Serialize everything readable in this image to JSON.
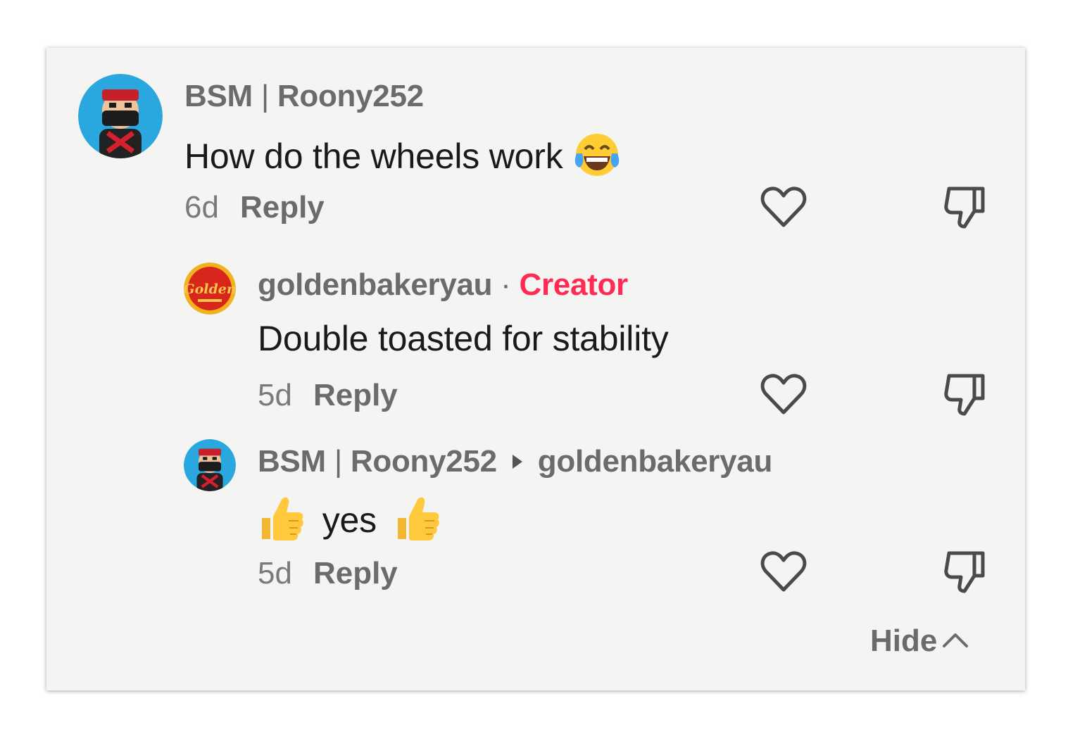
{
  "comments": [
    {
      "username": "BSM",
      "username_sep": "|",
      "username_rest": "Roony252",
      "text": "How do the wheels work",
      "emoji": "tears-of-joy-emoji",
      "age": "6d",
      "reply_label": "Reply"
    },
    {
      "username": "goldenbakeryau",
      "dot": "·",
      "badge": "Creator",
      "text": "Double toasted for stability",
      "age": "5d",
      "reply_label": "Reply"
    },
    {
      "username": "BSM",
      "username_sep": "|",
      "username_rest": "Roony252",
      "reply_to": "goldenbakeryau",
      "text": "yes",
      "emoji": "thumbs-up-emoji",
      "age": "5d",
      "reply_label": "Reply"
    }
  ],
  "hide_label": "Hide",
  "colors": {
    "background": "#f4f4f3",
    "creator_badge": "#fe2c55",
    "muted_text": "#6b6b6b",
    "body_text": "#1a1a1a"
  }
}
